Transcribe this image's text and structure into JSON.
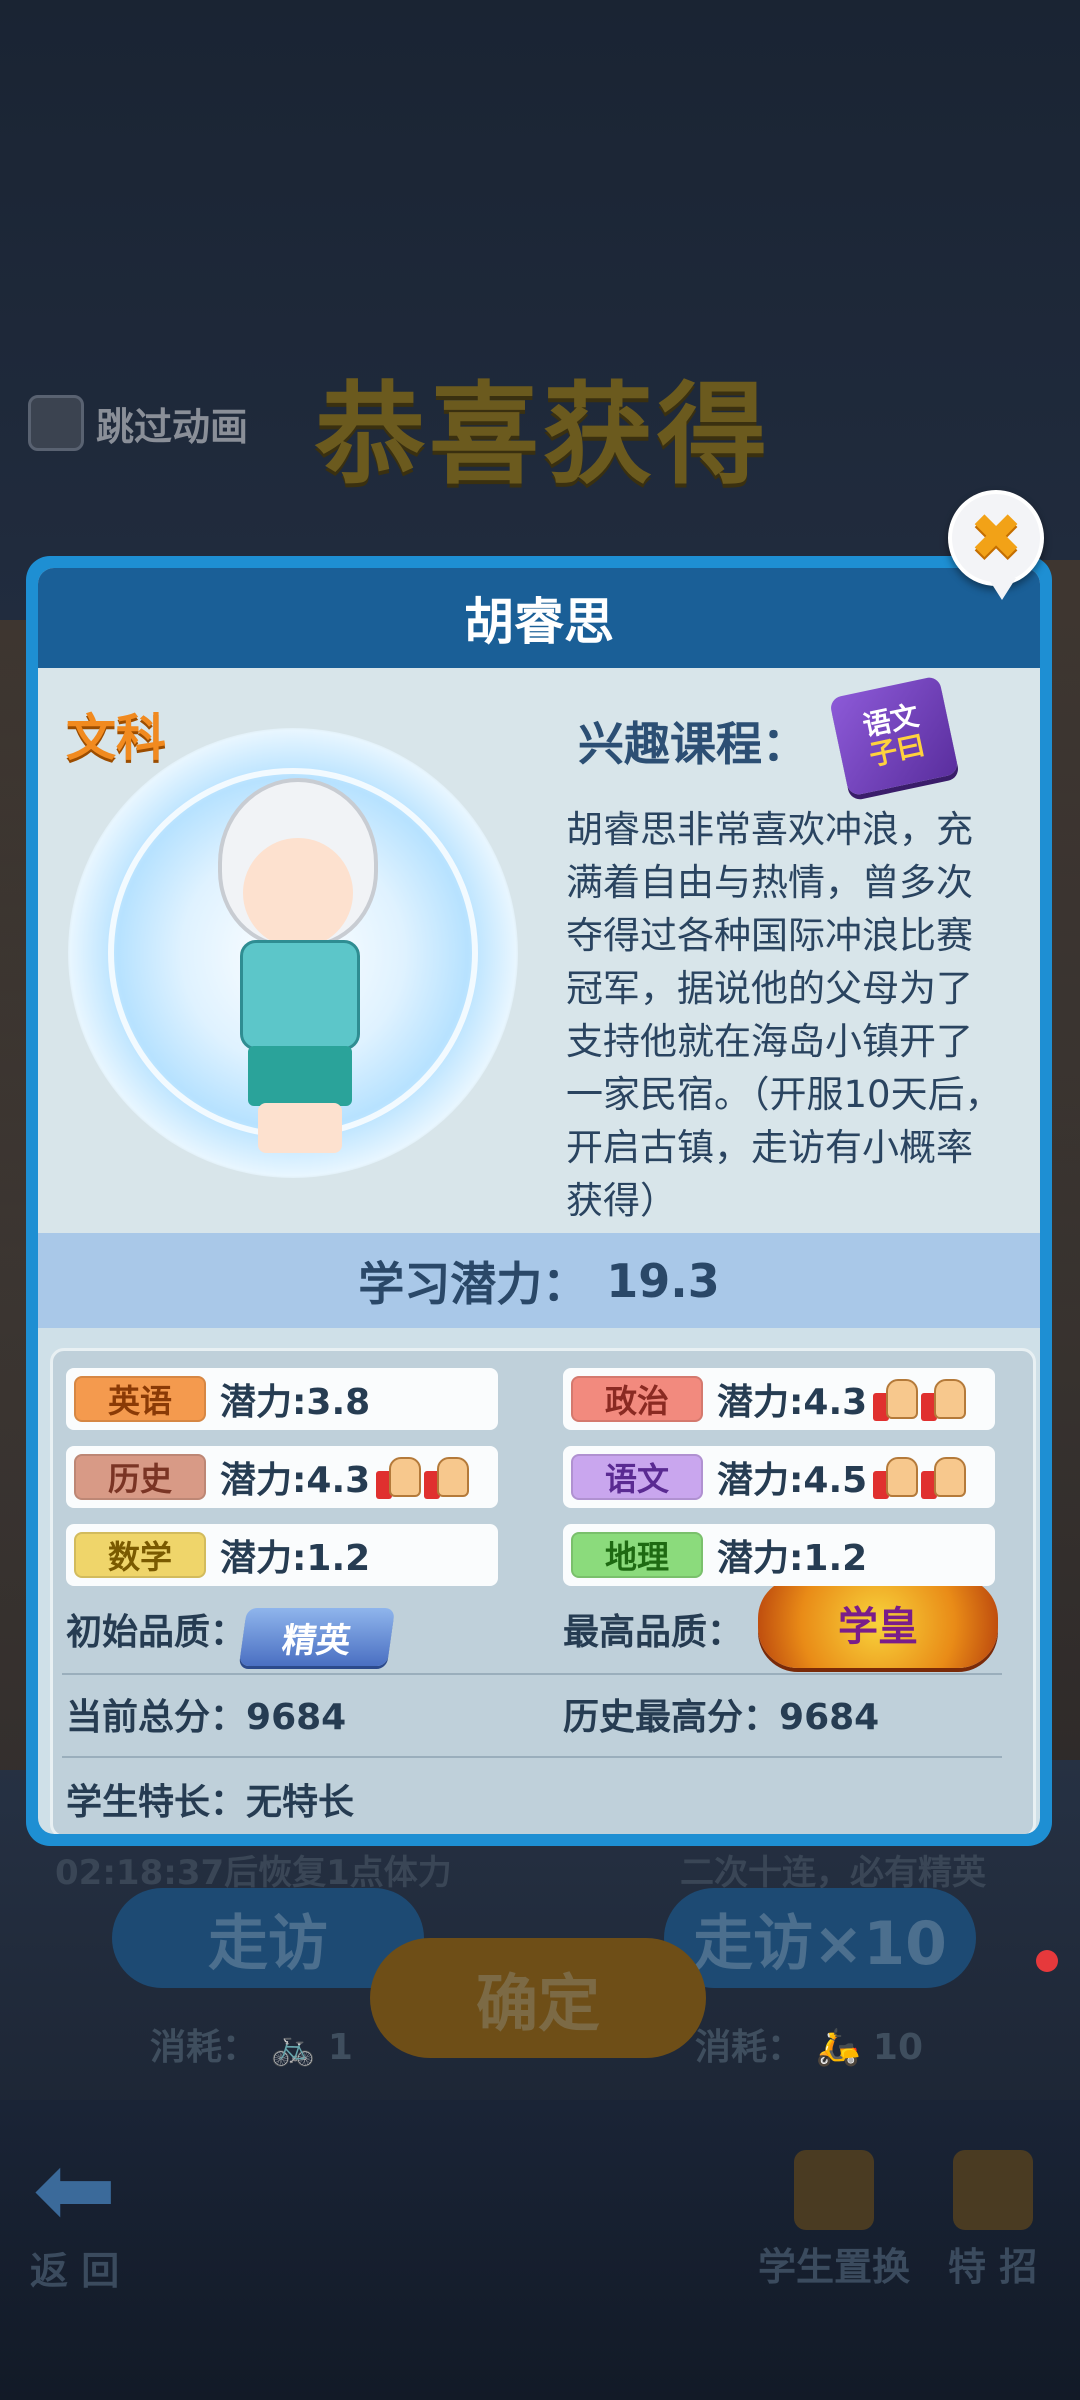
{
  "background": {
    "skip_label": "跳过动画",
    "congrats_title": "恭喜获得",
    "dim_timer_text": "02:18:37后恢复1点体力",
    "dim_guarantee_text": "二次十连，必有精英",
    "visit_button": "走访",
    "visit10_button": "走访×10",
    "confirm_button": "确定",
    "cost1_label": "消耗：",
    "cost1_value": "1",
    "cost10_label": "消耗：",
    "cost10_value": "10"
  },
  "bottom_nav": {
    "back_label": "返 回",
    "swap_label": "学生置换",
    "special_label": "特 招"
  },
  "dialog": {
    "name": "胡睿思",
    "category": "文科",
    "interest_label": "兴趣课程：",
    "interest_book_line1": "语文",
    "interest_book_line2": "子曰",
    "description": "胡睿思非常喜欢冲浪，充满着自由与热情，曾多次夺得过各种国际冲浪比赛冠军，据说他的父母为了支持他就在海岛小镇开了一家民宿。（开服10天后，开启古镇，走访有小概率获得）",
    "potential_label": "学习潜力：",
    "potential_value": "19.3",
    "subjects": [
      {
        "name": "英语",
        "potential": "潜力:3.8",
        "color": "#f49a4e",
        "text_color": "#8a3a06",
        "thumbs": 0
      },
      {
        "name": "政治",
        "potential": "潜力:4.3",
        "color": "#f28a7e",
        "text_color": "#8a2a22",
        "thumbs": 2
      },
      {
        "name": "历史",
        "potential": "潜力:4.3",
        "color": "#d89a86",
        "text_color": "#7a3424",
        "thumbs": 2
      },
      {
        "name": "语文",
        "potential": "潜力:4.5",
        "color": "#c9a6ee",
        "text_color": "#5a2a92",
        "thumbs": 2
      },
      {
        "name": "数学",
        "potential": "潜力:1.2",
        "color": "#efd56a",
        "text_color": "#7a5a00",
        "thumbs": 0
      },
      {
        "name": "地理",
        "potential": "潜力:1.2",
        "color": "#8bdb7c",
        "text_color": "#1e6a12",
        "thumbs": 0
      }
    ],
    "initial_quality_label": "初始品质：",
    "initial_quality_badge": "精英",
    "max_quality_label": "最高品质：",
    "max_quality_badge": "学皇",
    "current_score_label": "当前总分：",
    "current_score_value": "9684",
    "best_score_label": "历史最高分：",
    "best_score_value": "9684",
    "specialty_label": "学生特长：",
    "specialty_value": "无特长"
  }
}
